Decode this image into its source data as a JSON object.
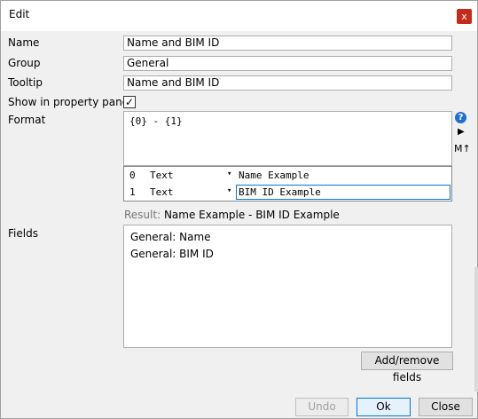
{
  "window": {
    "title": "Edit",
    "close_glyph": "x"
  },
  "form": {
    "name_label": "Name",
    "name_value": "Name and BIM ID",
    "group_label": "Group",
    "group_value": "General",
    "tooltip_label": "Tooltip",
    "tooltip_value": "Name and BIM ID",
    "show_label": "Show in property pane",
    "show_checked": "✓",
    "format_label": "Format",
    "format_value": "{0} - {1}"
  },
  "side": {
    "help_glyph": "?",
    "play_glyph": "▶",
    "md_label": "M↑"
  },
  "params": [
    {
      "index": "0",
      "type": "Text",
      "value": "Name Example"
    },
    {
      "index": "1",
      "type": "Text",
      "value": "BIM ID Example"
    }
  ],
  "result": {
    "label": "Result:",
    "value": "Name Example - BIM ID Example"
  },
  "fields": {
    "label": "Fields",
    "items": [
      "General: Name",
      "General: BIM ID"
    ],
    "add_remove_label": "Add/remove fields"
  },
  "footer": {
    "undo_label": "Undo",
    "ok_label": "Ok",
    "close_label": "Close"
  }
}
